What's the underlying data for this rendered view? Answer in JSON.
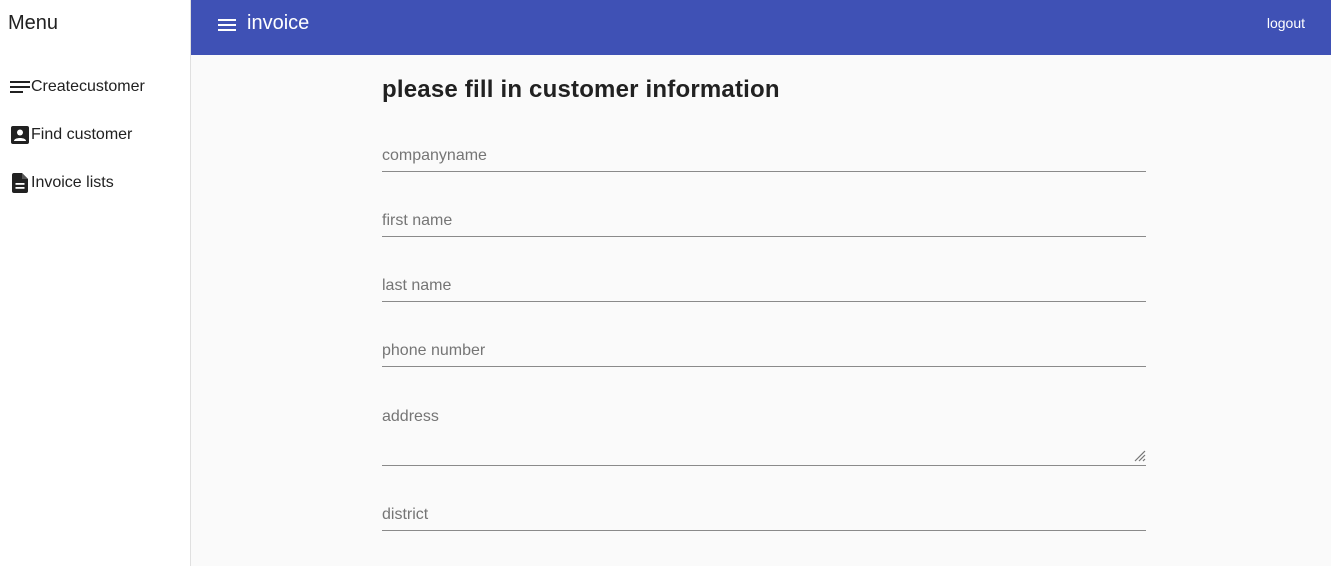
{
  "sidebar": {
    "title": "Menu",
    "items": [
      {
        "label": "Createcustomer",
        "icon": "list-lines-icon"
      },
      {
        "label": "Find customer",
        "icon": "contact-card-icon"
      },
      {
        "label": "Invoice lists",
        "icon": "document-icon"
      }
    ]
  },
  "topbar": {
    "title": "invoice",
    "menu_icon": "hamburger-menu-icon",
    "logout_label": "logout",
    "color": "#3f51b5"
  },
  "form": {
    "title": "please fill in customer information",
    "fields": {
      "companyname": {
        "placeholder": "companyname",
        "value": ""
      },
      "first_name": {
        "placeholder": "first name",
        "value": ""
      },
      "last_name": {
        "placeholder": "last name",
        "value": ""
      },
      "phone_number": {
        "placeholder": "phone number",
        "value": ""
      },
      "address": {
        "placeholder": "address",
        "value": ""
      },
      "district": {
        "placeholder": "district",
        "value": ""
      }
    }
  }
}
